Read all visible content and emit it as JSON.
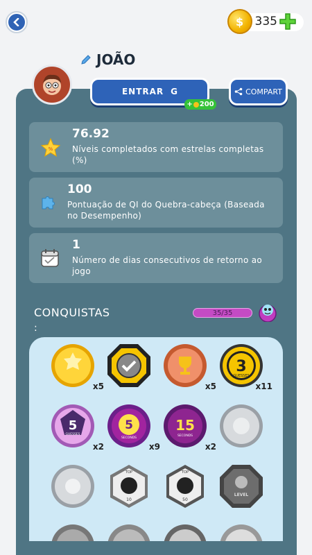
{
  "header": {
    "coins": "335",
    "player_name": "JOÃO"
  },
  "actions": {
    "login_label": "ENTRAR",
    "login_icon_letter": "G",
    "login_bonus": "200",
    "bonus_plus": "+",
    "share_label": "COMPART"
  },
  "stats": [
    {
      "value": "76.92",
      "description": "Níveis completados com estrelas completas (%)",
      "icon": "star-icon"
    },
    {
      "value": "100",
      "description": "Pontuação de QI do Quebra-cabeça (Baseada no Desempenho)",
      "icon": "puzzle-icon"
    },
    {
      "value": "1",
      "description": "Número de dias consecutivos de retorno ao jogo",
      "icon": "calendar-icon"
    }
  ],
  "achievements": {
    "title": "CONQUISTAS",
    "colon": ":",
    "progress": "35/35",
    "badges": [
      {
        "name": "gold-badge",
        "count": "x5",
        "label": ""
      },
      {
        "name": "check-badge",
        "count": "",
        "label": ""
      },
      {
        "name": "trophy-badge",
        "count": "x5",
        "label": ""
      },
      {
        "name": "guesses-3-badge",
        "count": "x11",
        "label": "3",
        "sub": "GUESSES"
      },
      {
        "name": "guesses-5-badge",
        "count": "x2",
        "label": "5",
        "sub": "GUESSES"
      },
      {
        "name": "seconds-5-badge",
        "count": "x9",
        "label": "5",
        "sub": "SECONDS"
      },
      {
        "name": "seconds-15-badge",
        "count": "x2",
        "label": "15",
        "sub": "SECONDS"
      },
      {
        "name": "silver-badge",
        "count": "",
        "label": ""
      },
      {
        "name": "silver-sun-badge",
        "count": "",
        "label": ""
      },
      {
        "name": "top-10-badge",
        "count": "",
        "label": "10",
        "sub": "TOP"
      },
      {
        "name": "top-50-badge",
        "count": "",
        "label": "50",
        "sub": "TOP"
      },
      {
        "name": "level-badge",
        "count": "",
        "label": "LEVEL"
      }
    ]
  }
}
